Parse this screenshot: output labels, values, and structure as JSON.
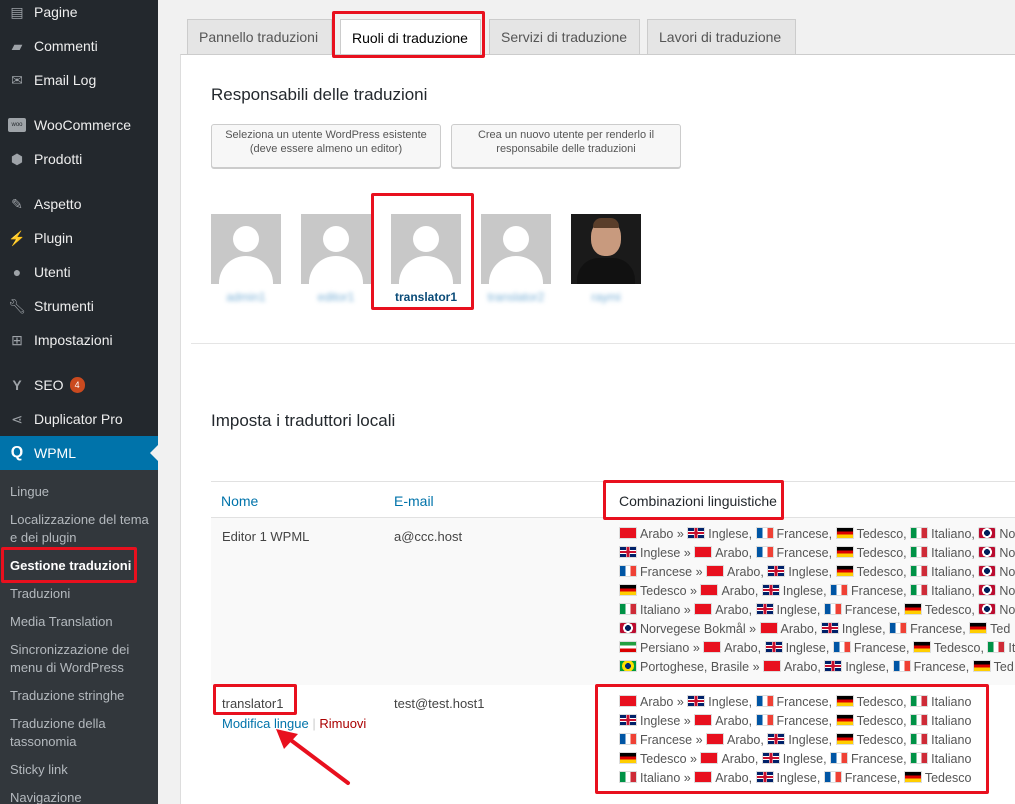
{
  "sidebar": {
    "items": [
      {
        "label": "Pagine",
        "icon": "pages-icon"
      },
      {
        "label": "Commenti",
        "icon": "comment-icon"
      },
      {
        "label": "Email Log",
        "icon": "email-icon"
      },
      {
        "label": "WooCommerce",
        "icon": "woocommerce-icon"
      },
      {
        "label": "Prodotti",
        "icon": "box-icon"
      },
      {
        "label": "Aspetto",
        "icon": "brush-icon"
      },
      {
        "label": "Plugin",
        "icon": "plug-icon"
      },
      {
        "label": "Utenti",
        "icon": "user-icon"
      },
      {
        "label": "Strumenti",
        "icon": "wrench-icon"
      },
      {
        "label": "Impostazioni",
        "icon": "settings-icon"
      },
      {
        "label": "SEO",
        "icon": "yoast-icon",
        "badge": "4"
      },
      {
        "label": "Duplicator Pro",
        "icon": "share-icon"
      },
      {
        "label": "WPML",
        "icon": "wpml-icon"
      }
    ],
    "submenu": [
      "Lingue",
      "Localizzazione del tema e dei plugin",
      "Gestione traduzioni",
      "Traduzioni",
      "Media Translation",
      "Sincronizzazione dei menu di WordPress",
      "Traduzione stringhe",
      "Traduzione della tassonomia",
      "Sticky link",
      "Navigazione"
    ]
  },
  "tabs": [
    "Pannello traduzioni",
    "Ruoli di traduzione",
    "Servizi di traduzione",
    "Lavori di traduzione"
  ],
  "managers": {
    "title": "Responsabili delle traduzioni",
    "btn_existing": "Seleziona un utente WordPress esistente (deve essere almeno un editor)",
    "btn_new": "Crea un nuovo utente per renderlo il responsabile delle traduzioni",
    "users": [
      "admin1",
      "editor1",
      "translator1",
      "translator2",
      "raymi"
    ]
  },
  "local": {
    "title": "Imposta i traduttori locali",
    "headers": {
      "name": "Nome",
      "email": "E-mail",
      "combos": "Combinazioni linguistiche"
    },
    "rows": [
      {
        "name": "Editor 1 WPML",
        "email": "a@ccc.host",
        "combos": [
          "Arabo » Inglese, Francese, Tedesco, Italiano, No",
          "Inglese » Arabo, Francese, Tedesco, Italiano, No",
          "Francese » Arabo, Inglese, Tedesco, Italiano, No",
          "Tedesco » Arabo, Inglese, Francese, Italiano, No",
          "Italiano » Arabo, Inglese, Francese, Tedesco, No",
          "Norvegese Bokmål » Arabo, Inglese, Francese, Ted",
          "Persiano » Arabo, Inglese, Francese, Tedesco, It",
          "Portoghese, Brasile » Arabo, Inglese, Francese, Ted"
        ]
      },
      {
        "name": "translator1",
        "email": "test@test.host1",
        "edit": "Modifica lingue",
        "sep": "|",
        "remove": "Rimuovi",
        "combos": [
          "Arabo » Inglese, Francese, Tedesco, Italiano",
          "Inglese » Arabo, Francese, Tedesco, Italiano",
          "Francese » Arabo, Inglese, Tedesco, Italiano",
          "Tedesco » Arabo, Inglese, Francese, Italiano",
          "Italiano » Arabo, Inglese, Francese, Tedesco"
        ]
      }
    ]
  },
  "colors": {
    "highlight": "#e8101e",
    "wp_blue": "#0073aa",
    "sidebar": "#23282d"
  }
}
